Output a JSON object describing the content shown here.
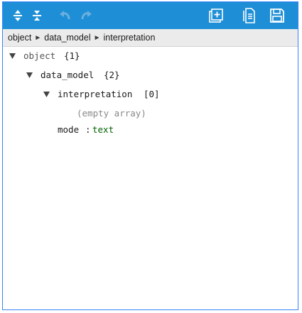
{
  "toolbar": {
    "buttons": [
      {
        "name": "expand-all-button",
        "icon": "expand-all-icon",
        "enabled": true
      },
      {
        "name": "collapse-all-button",
        "icon": "collapse-all-icon",
        "enabled": true
      },
      {
        "name": "undo-button",
        "icon": "undo-icon",
        "enabled": false
      },
      {
        "name": "redo-button",
        "icon": "redo-icon",
        "enabled": false
      },
      {
        "name": "add-button",
        "icon": "add-square-icon",
        "enabled": true
      },
      {
        "name": "copy-button",
        "icon": "document-icon",
        "enabled": true
      },
      {
        "name": "save-button",
        "icon": "floppy-disk-icon",
        "enabled": true
      }
    ],
    "accent": "#1e8fd6"
  },
  "breadcrumb": {
    "items": [
      "object",
      "data_model",
      "interpretation"
    ],
    "separator": "►"
  },
  "tree": {
    "root": {
      "key": "object",
      "count": "{1}"
    },
    "data_model": {
      "key": "data_model",
      "count": "{2}"
    },
    "interpretation": {
      "key": "interpretation",
      "count": "[0]",
      "empty_label": "(empty array)"
    },
    "mode": {
      "key": "mode",
      "separator": ":",
      "value": "text"
    }
  }
}
